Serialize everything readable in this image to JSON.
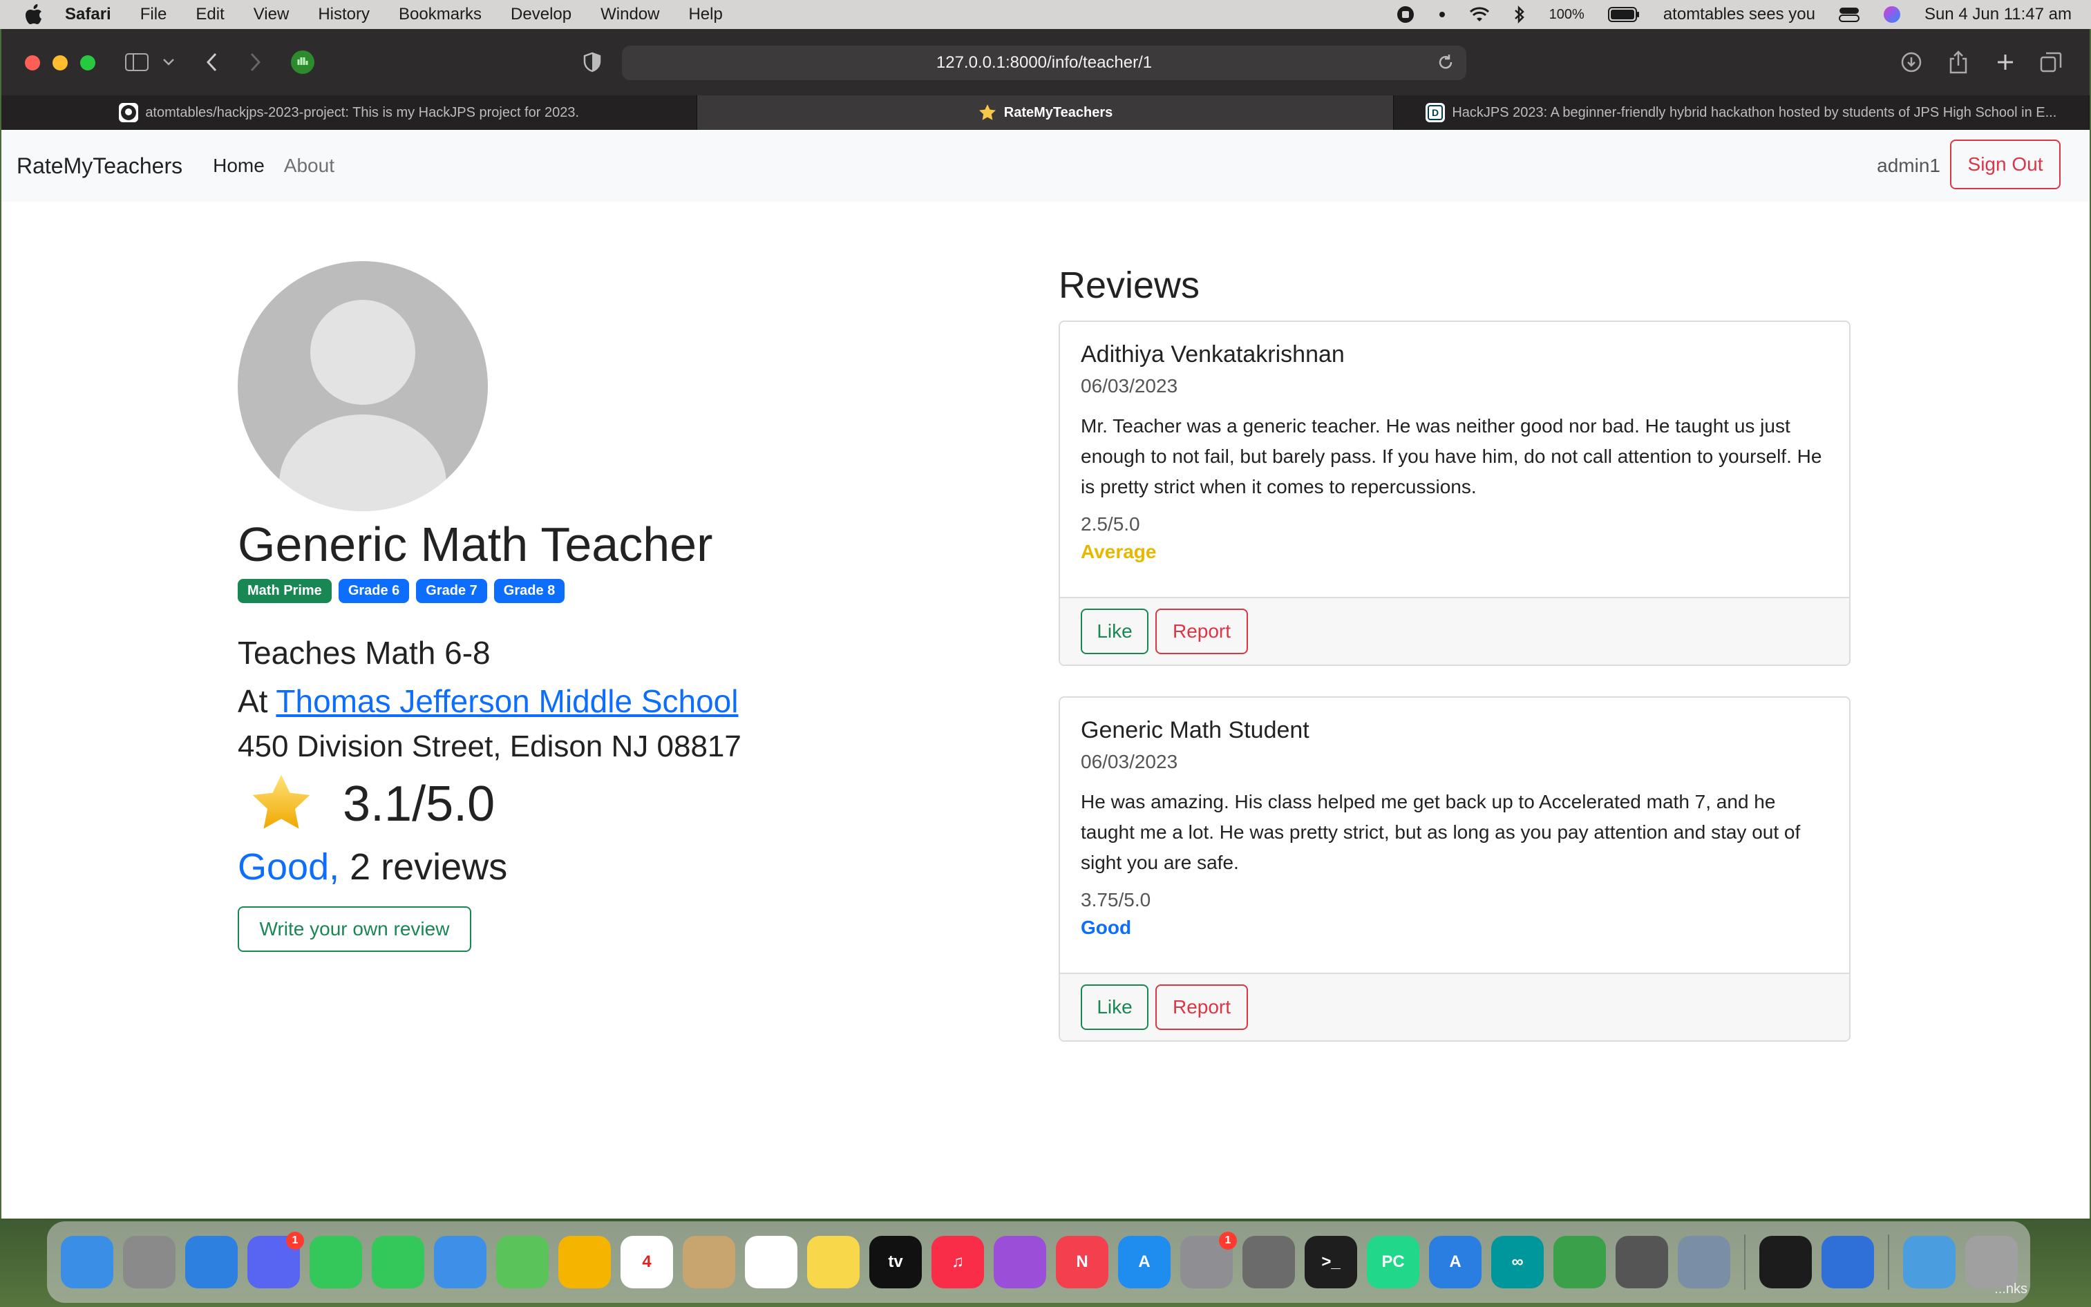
{
  "menubar": {
    "app_name": "Safari",
    "items": [
      "File",
      "Edit",
      "View",
      "History",
      "Bookmarks",
      "Develop",
      "Window",
      "Help"
    ],
    "battery": "100%",
    "user_message": "atomtables sees you",
    "datetime": "Sun 4 Jun  11:47 am"
  },
  "browser": {
    "url": "127.0.0.1:8000/info/teacher/1",
    "tabs": [
      {
        "title": "atomtables/hackjps-2023-project: This is my HackJPS project for 2023.",
        "icon": "github-icon",
        "active": false
      },
      {
        "title": "RateMyTeachers",
        "icon": "star-icon",
        "active": true
      },
      {
        "title": "HackJPS 2023: A beginner-friendly hybrid hackathon hosted by students of JPS High School in E...",
        "icon": "devpost-icon",
        "active": false
      }
    ]
  },
  "navbar": {
    "brand": "RateMyTeachers",
    "links": [
      "Home",
      "About"
    ],
    "username": "admin1",
    "signout_label": "Sign Out"
  },
  "teacher": {
    "name": "Generic Math Teacher",
    "badges": [
      {
        "label": "Math Prime",
        "color": "#198754"
      },
      {
        "label": "Grade 6",
        "color": "#0d6efd"
      },
      {
        "label": "Grade 7",
        "color": "#0d6efd"
      },
      {
        "label": "Grade 8",
        "color": "#0d6efd"
      }
    ],
    "teaches": "Teaches Math 6-8",
    "at_prefix": "At ",
    "school": "Thomas Jefferson Middle School",
    "address": "450 Division Street, Edison NJ 08817",
    "score": "3.1/5.0",
    "rating_word": "Good,",
    "review_count": " 2 reviews",
    "write_review_label": "Write your own review"
  },
  "reviews": {
    "title": "Reviews",
    "items": [
      {
        "reviewer": "Adithiya Venkatakrishnan",
        "date": "06/03/2023",
        "text": "Mr. Teacher was a generic teacher. He was neither good nor bad. He taught us just enough to not fail, but barely pass. If you have him, do not call attention to yourself. He is pretty strict when it comes to repercussions.",
        "score": "2.5/5.0",
        "rating_word": "Average",
        "rating_color": "#e6b800",
        "like_label": "Like",
        "report_label": "Report"
      },
      {
        "reviewer": "Generic Math Student",
        "date": "06/03/2023",
        "text": "He was amazing. His class helped me get back up to Accelerated math 7, and he taught me a lot. He was pretty strict, but as long as you pay attention and stay out of sight you are safe.",
        "score": "3.75/5.0",
        "rating_word": "Good",
        "rating_color": "#0d6efd",
        "like_label": "Like",
        "report_label": "Report"
      }
    ]
  },
  "dock": {
    "apps": [
      {
        "name": "finder",
        "color": "#3a8ee6",
        "glyph": ""
      },
      {
        "name": "launchpad",
        "color": "#8a8a8a",
        "glyph": ""
      },
      {
        "name": "safari",
        "color": "#2d7fe0",
        "glyph": ""
      },
      {
        "name": "discord",
        "color": "#5865f2",
        "glyph": "",
        "badge": ""
      },
      {
        "name": "messages",
        "color": "#34c759",
        "glyph": ""
      },
      {
        "name": "facetime",
        "color": "#34c759",
        "glyph": ""
      },
      {
        "name": "mail",
        "color": "#3d8fe8",
        "glyph": ""
      },
      {
        "name": "maps",
        "color": "#5ac45a",
        "glyph": ""
      },
      {
        "name": "photos",
        "color": "#f4b400",
        "glyph": ""
      },
      {
        "name": "calendar",
        "color": "#ffffff",
        "glyph": "4"
      },
      {
        "name": "contacts",
        "color": "#c8a46e",
        "glyph": ""
      },
      {
        "name": "reminders",
        "color": "#ffffff",
        "glyph": ""
      },
      {
        "name": "notes",
        "color": "#f8d74a",
        "glyph": ""
      },
      {
        "name": "apple-tv",
        "color": "#111111",
        "glyph": "tv"
      },
      {
        "name": "music",
        "color": "#fa2d48",
        "glyph": "♫"
      },
      {
        "name": "podcasts",
        "color": "#9b4fd8",
        "glyph": ""
      },
      {
        "name": "news",
        "color": "#f43f4f",
        "glyph": "N"
      },
      {
        "name": "app-store",
        "color": "#1f8cf0",
        "glyph": "A"
      },
      {
        "name": "system-settings",
        "color": "#8e8e93",
        "glyph": "",
        "badge": "1"
      },
      {
        "name": "compressor",
        "color": "#6b6b6b",
        "glyph": ""
      },
      {
        "name": "terminal",
        "color": "#1e1e1e",
        "glyph": ">_"
      },
      {
        "name": "pycharm",
        "color": "#21d789",
        "glyph": "PC"
      },
      {
        "name": "xcode-instruments",
        "color": "#2a7de1",
        "glyph": "A"
      },
      {
        "name": "arduino",
        "color": "#00979c",
        "glyph": "∞"
      },
      {
        "name": "gns3",
        "color": "#3aa14a",
        "glyph": ""
      },
      {
        "name": "screenshot",
        "color": "#555555",
        "glyph": ""
      },
      {
        "name": "preview",
        "color": "#7a8fa6",
        "glyph": ""
      },
      {
        "name": "activity-monitor",
        "color": "#1c1c1c",
        "glyph": ""
      },
      {
        "name": "quicktime",
        "color": "#2e6fd8",
        "glyph": ""
      },
      {
        "name": "downloads",
        "color": "#4a9ee0",
        "glyph": ""
      },
      {
        "name": "trash",
        "color": "#a0a0a0",
        "glyph": ""
      }
    ],
    "badge_discord": "1",
    "corner_label": "...nks"
  }
}
